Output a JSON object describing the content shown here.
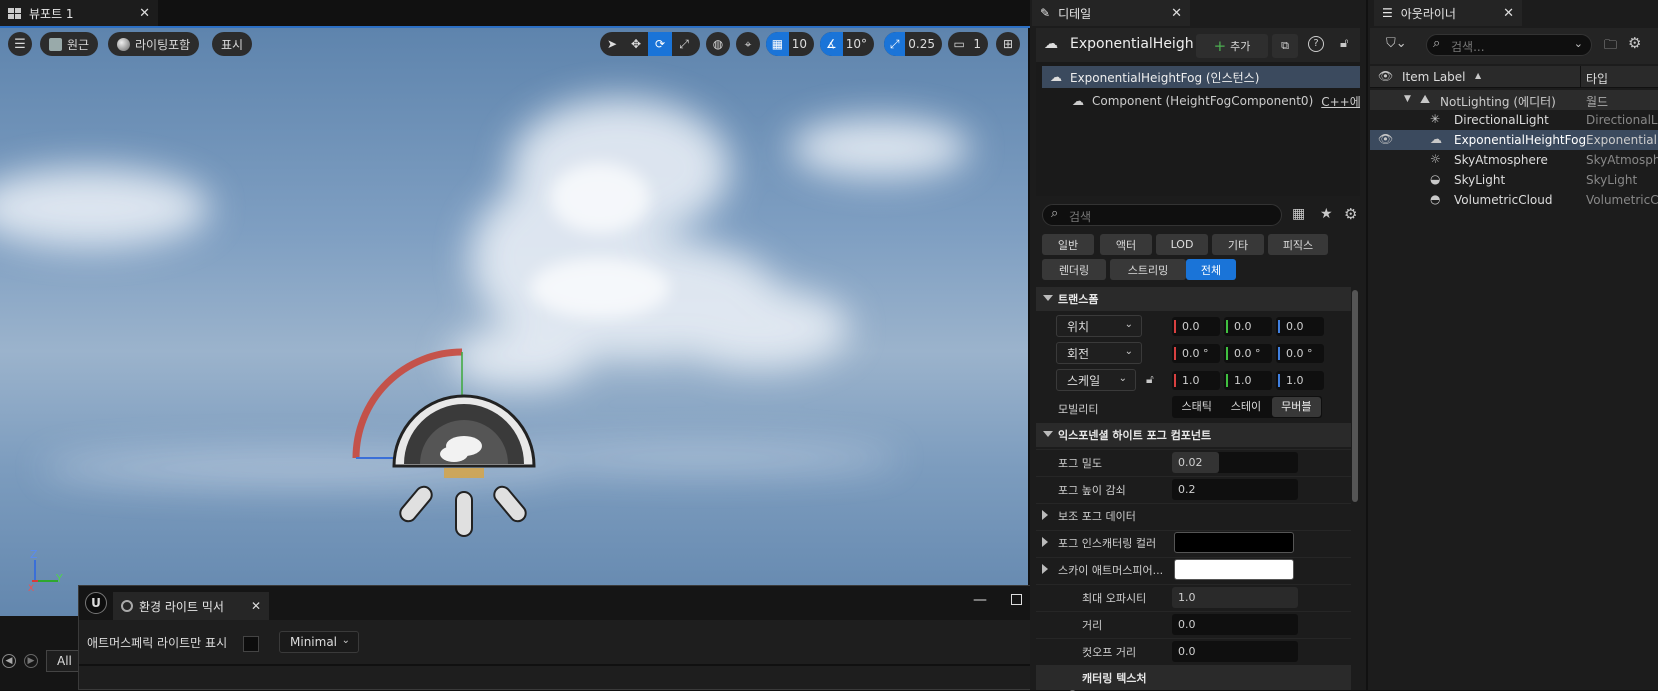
{
  "viewport": {
    "tab": "뷰포트 1",
    "btn_perspective": "원근",
    "btn_lit": "라이팅포함",
    "btn_show": "표시",
    "grid_snap": "10",
    "rot_snap": "10°",
    "scale_snap": "0.25",
    "cam_speed": "1",
    "axes": {
      "z": "Z",
      "y": "Y",
      "x": "X"
    }
  },
  "mixer": {
    "title": "환경 라이트 믹서",
    "checkbox_label": "애트머스페릭 라이트만 표시",
    "dropdown": "Minimal"
  },
  "bottom": {
    "filter": "All"
  },
  "details": {
    "tab": "디테일",
    "actor_name": "ExponentialHeigh",
    "add_btn": "추가",
    "tree": {
      "root": "ExponentialHeightFog (인스턴스)",
      "component": "Component (HeightFogComponent0)",
      "component_note": "C++에서 편"
    },
    "search_placeholder": "검색",
    "filters_row1": [
      "일반",
      "액터",
      "LOD",
      "기타",
      "피직스"
    ],
    "filters_row2": [
      "렌더링",
      "스트리밍",
      "전체"
    ],
    "sec_transform": "트랜스폼",
    "location": {
      "label": "위치",
      "x": "0.0",
      "y": "0.0",
      "z": "0.0"
    },
    "rotation": {
      "label": "회전",
      "x": "0.0 °",
      "y": "0.0 °",
      "z": "0.0 °"
    },
    "scale": {
      "label": "스케일",
      "x": "1.0",
      "y": "1.0",
      "z": "1.0"
    },
    "mobility": {
      "label": "모빌리티",
      "opts": [
        "스태틱",
        "스테이",
        "무버블"
      ]
    },
    "sec_fog": "익스포넨셜 하이트 포그 컴포넌트",
    "props": [
      {
        "label": "포그 밀도",
        "value": "0.02"
      },
      {
        "label": "포그 높이 감쇠",
        "value": "0.2"
      },
      {
        "label": "보조 포그 데이터"
      },
      {
        "label": "포그 인스캐터링 컬러"
      },
      {
        "label": "스카이 애트머스피어...",
        "value": ""
      },
      {
        "label": "최대 오파시티",
        "value": "1.0"
      },
      {
        "label": "거리",
        "value": "0.0"
      },
      {
        "label": "컷오프 거리",
        "value": "0.0"
      },
      {
        "label": "캐터링 텍스처"
      }
    ],
    "colors": {
      "inscatter": "#000000",
      "sky": "#ffffff"
    }
  },
  "outliner": {
    "tab": "아웃라이너",
    "search_placeholder": "검색...",
    "col_label": "Item Label",
    "col_type": "타입",
    "rows": [
      {
        "name": "NotLighting (에디터)",
        "type": "월드"
      },
      {
        "name": "DirectionalLight",
        "type": "DirectionalLi"
      },
      {
        "name": "ExponentialHeightFog",
        "type": "ExponentialH"
      },
      {
        "name": "SkyAtmosphere",
        "type": "SkyAtmosph"
      },
      {
        "name": "SkyLight",
        "type": "SkyLight"
      },
      {
        "name": "VolumetricCloud",
        "type": "VolumetricC"
      }
    ]
  }
}
